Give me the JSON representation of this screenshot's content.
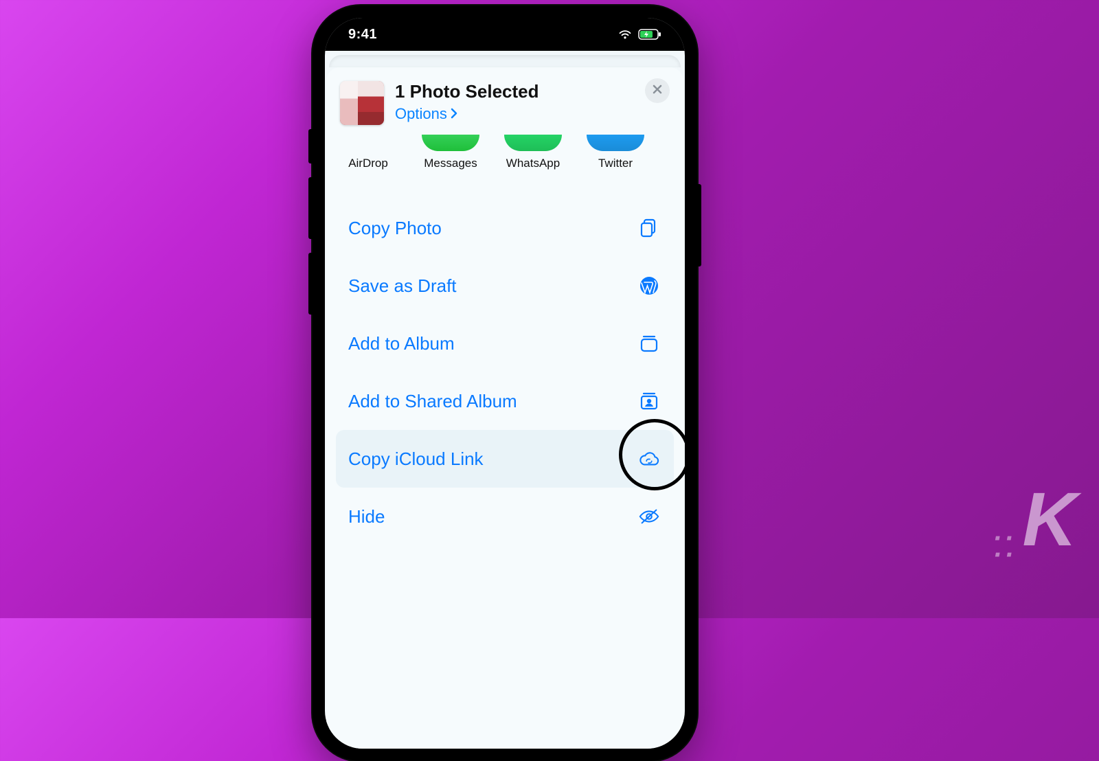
{
  "status": {
    "time": "9:41"
  },
  "sheet": {
    "title": "1 Photo Selected",
    "options_label": "Options"
  },
  "apps": [
    {
      "label": "AirDrop",
      "pillClass": "pill-airdrop"
    },
    {
      "label": "Messages",
      "pillClass": "pill-messages"
    },
    {
      "label": "WhatsApp",
      "pillClass": "pill-whatsapp"
    },
    {
      "label": "Twitter",
      "pillClass": "pill-twitter"
    }
  ],
  "actions": [
    {
      "label": "Copy Photo",
      "icon": "copy-icon"
    },
    {
      "label": "Save as Draft",
      "icon": "wordpress-icon"
    },
    {
      "label": "Add to Album",
      "icon": "album-icon"
    },
    {
      "label": "Add to Shared Album",
      "icon": "shared-album-icon"
    },
    {
      "label": "Copy iCloud Link",
      "icon": "cloud-link-icon",
      "highlight": true,
      "circled": true
    },
    {
      "label": "Hide",
      "icon": "eye-slash-icon"
    }
  ],
  "watermark": "K"
}
